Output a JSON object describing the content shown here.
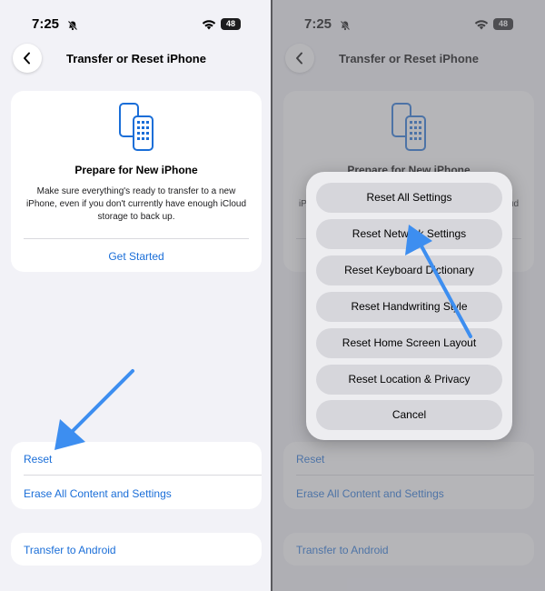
{
  "status_bar": {
    "time": "7:25",
    "battery": "48"
  },
  "nav": {
    "title": "Transfer or Reset iPhone"
  },
  "prepare_card": {
    "title": "Prepare for New iPhone",
    "body": "Make sure everything's ready to transfer to a new iPhone, even if you don't currently have enough iCloud storage to back up.",
    "link": "Get Started"
  },
  "reset_section": {
    "reset": "Reset",
    "erase": "Erase All Content and Settings"
  },
  "transfer_android": "Transfer to Android",
  "reset_menu": {
    "items": [
      "Reset All Settings",
      "Reset Network Settings",
      "Reset Keyboard Dictionary",
      "Reset Handwriting Style",
      "Reset Home Screen Layout",
      "Reset Location & Privacy",
      "Cancel"
    ]
  },
  "colors": {
    "accent": "#1a6ed8",
    "annotation_arrow": "#3d8ef0",
    "background": "#f2f2f7"
  }
}
